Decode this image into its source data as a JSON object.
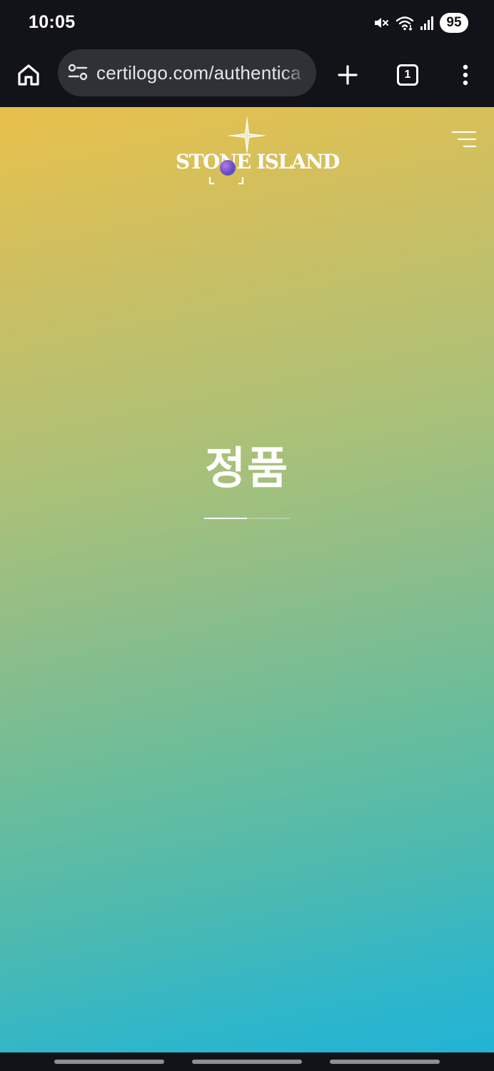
{
  "status_bar": {
    "time": "10:05",
    "battery_level": "95",
    "icons": [
      "mute-icon",
      "wifi-icon",
      "signal-icon"
    ]
  },
  "browser": {
    "url": "certilogo.com/authentica",
    "tab_count": "1",
    "icons": [
      "home-icon",
      "site-settings-icon",
      "new-tab-icon",
      "tab-switcher-icon",
      "more-options-icon"
    ]
  },
  "page": {
    "logo_text": "STONE ISLAND",
    "hero_title": "정품",
    "colors": {
      "gradient_top": "#e8c04b",
      "gradient_middle": "#8cbd8a",
      "gradient_bottom": "#22b3d5",
      "browser_chrome": "#121318"
    }
  }
}
